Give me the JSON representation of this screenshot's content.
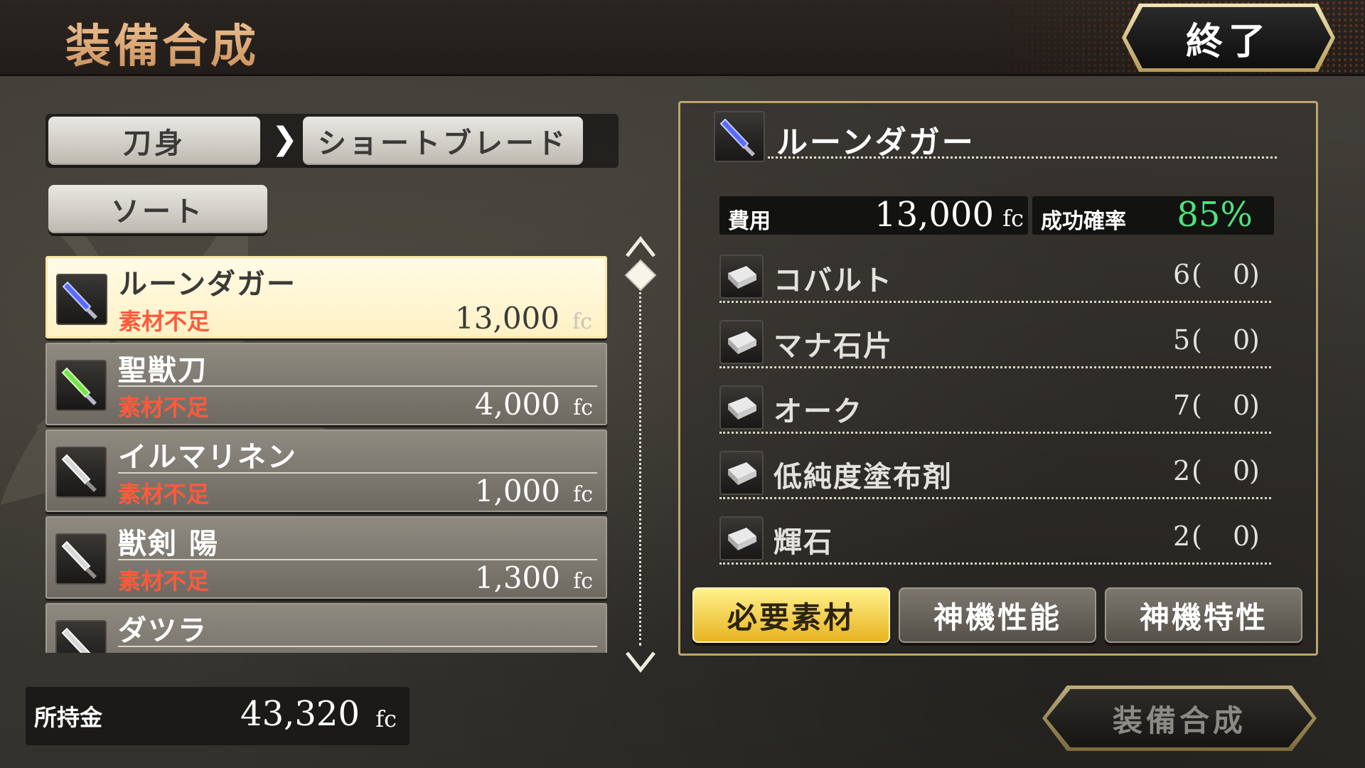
{
  "header": {
    "title": "装備合成",
    "end_label": "終了"
  },
  "breadcrumb": {
    "category": "刀身",
    "separator": "❯",
    "subcategory": "ショートブレード"
  },
  "sort": {
    "label": "ソート"
  },
  "list": {
    "items": [
      {
        "name": "ルーンダガー",
        "status": "素材不足",
        "price": "13,000",
        "unit": "fc",
        "icon": "rune-dagger-icon",
        "icon_color": "#5a6bff",
        "selected": true
      },
      {
        "name": "聖獣刀",
        "status": "素材不足",
        "price": "4,000",
        "unit": "fc",
        "icon": "holy-beast-sword-icon",
        "icon_color": "#79e24c",
        "selected": false
      },
      {
        "name": "イルマリネン",
        "status": "素材不足",
        "price": "1,000",
        "unit": "fc",
        "icon": "dagger-icon",
        "icon_color": "#d8d8d8",
        "selected": false
      },
      {
        "name": "獣剣 陽",
        "status": "素材不足",
        "price": "1,300",
        "unit": "fc",
        "icon": "dagger-icon",
        "icon_color": "#d8d8d8",
        "selected": false
      },
      {
        "name": "ダツラ",
        "status": "",
        "price": "",
        "unit": "",
        "icon": "dagger-icon",
        "icon_color": "#d8d8d8",
        "selected": false
      }
    ]
  },
  "money": {
    "label": "所持金",
    "value": "43,320",
    "unit": "fc"
  },
  "detail": {
    "title": "ルーンダガー",
    "cost_label": "費用",
    "cost_value": "13,000",
    "cost_unit": "fc",
    "success_label": "成功確率",
    "success_value": "85%",
    "materials": [
      {
        "name": "コバルト",
        "required": "6",
        "owned": "0"
      },
      {
        "name": "マナ石片",
        "required": "5",
        "owned": "0"
      },
      {
        "name": "オーク",
        "required": "7",
        "owned": "0"
      },
      {
        "name": "低純度塗布剤",
        "required": "2",
        "owned": "0"
      },
      {
        "name": "輝石",
        "required": "2",
        "owned": "0"
      }
    ],
    "tabs": [
      {
        "label": "必要素材",
        "active": true
      },
      {
        "label": "神機性能",
        "active": false
      },
      {
        "label": "神機特性",
        "active": false
      }
    ]
  },
  "synthesize_button": {
    "label": "装備合成"
  },
  "colors": {
    "accent_gold": "#e8b321",
    "status_red": "#ff5a3c",
    "success_green": "#4de27d",
    "panel_border": "#bca66c"
  }
}
